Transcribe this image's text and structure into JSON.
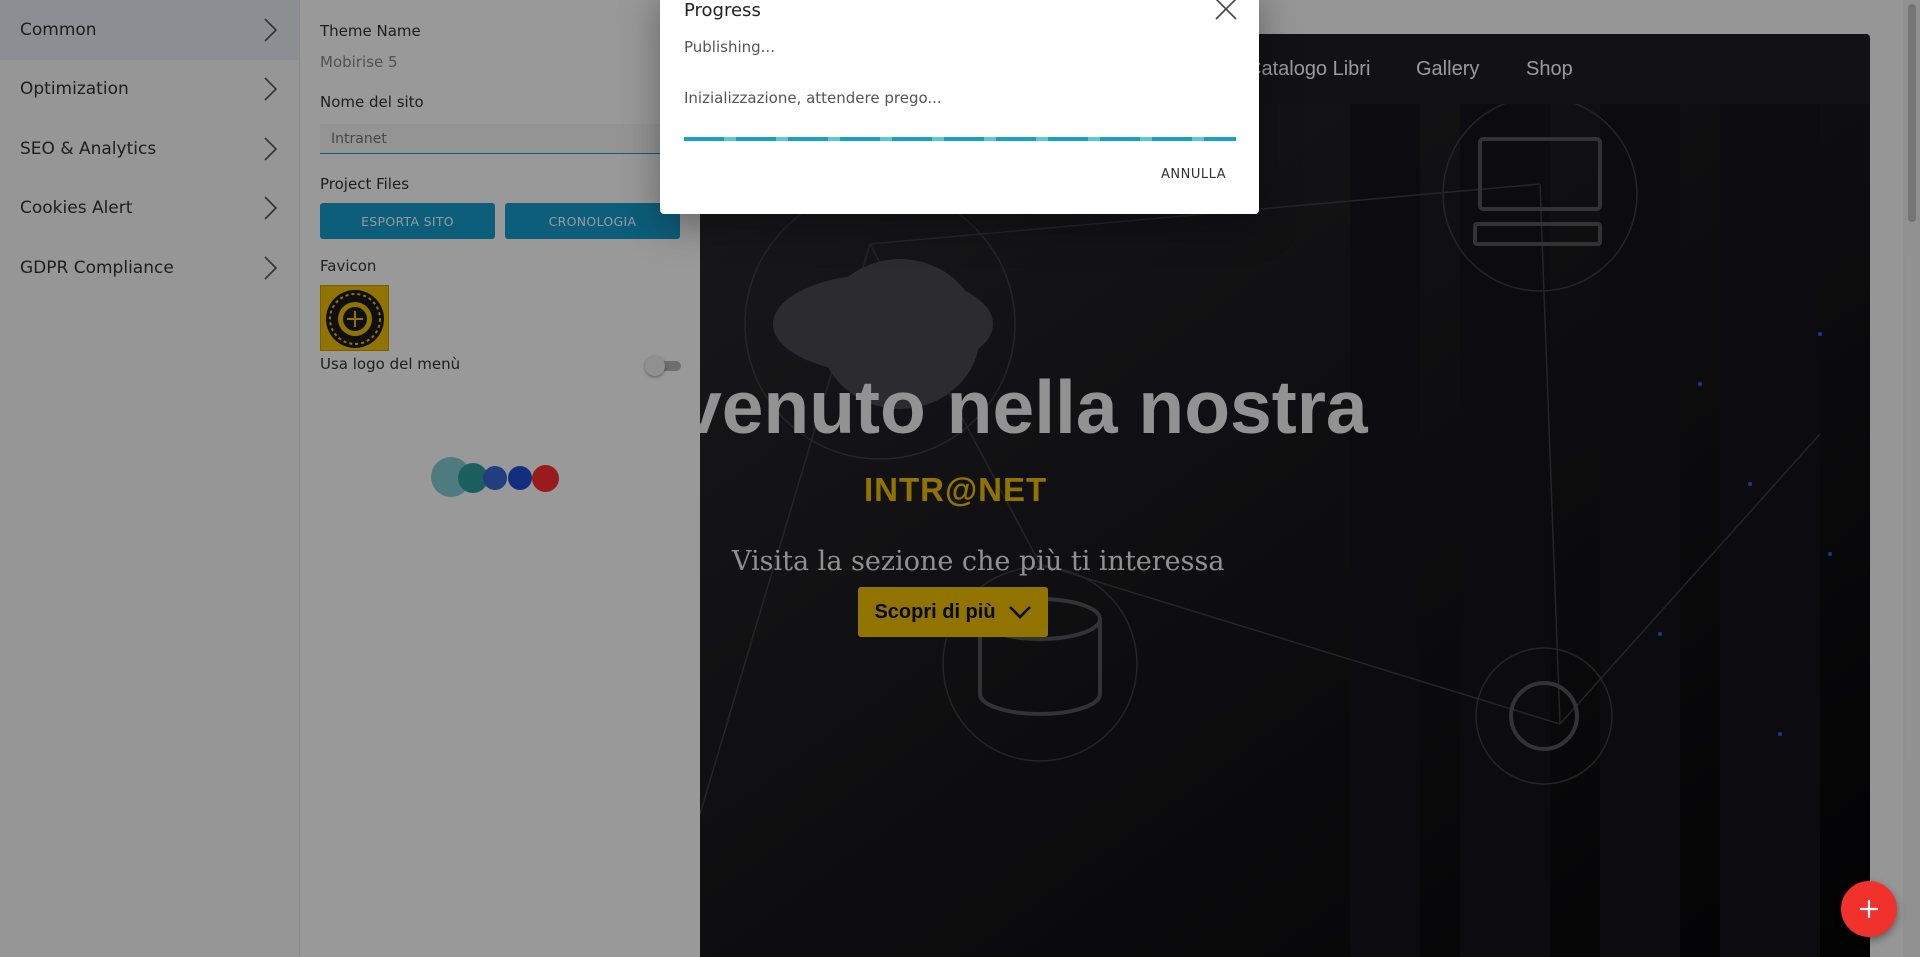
{
  "left_menu": {
    "items": [
      {
        "label": "Common",
        "active": true
      },
      {
        "label": "Optimization"
      },
      {
        "label": "SEO & Analytics"
      },
      {
        "label": "Cookies Alert"
      },
      {
        "label": "GDPR Compliance"
      }
    ]
  },
  "settings": {
    "theme_label": "Theme Name",
    "theme_value": "Mobirise 5",
    "site_name_label": "Nome del sito",
    "site_name_value": "Intranet",
    "project_files_label": "Project Files",
    "export_button": "ESPORTA SITO",
    "history_button": "CRONOLOGIA",
    "favicon_label": "Favicon",
    "use_logo_label": "Usa logo del menù",
    "use_logo_on": false
  },
  "preview": {
    "nav_links": [
      "Catalogo Libri",
      "Gallery",
      "Shop"
    ],
    "hero_title": "venuto nella nostra",
    "hero_brand": "INTR@NET",
    "hero_subtitle": "Visita la sezione che più ti interessa",
    "hero_button": "Scopri di più"
  },
  "progress_dialog": {
    "title": "Progress",
    "status": "Publishing...",
    "message": "Inizializzazione, attendere prego...",
    "progress": 1.0,
    "cancel_button": "ANNULLA"
  },
  "colors": {
    "accent": "#149dcc",
    "brand_yellow": "#f2c200",
    "fab": "#f0312c"
  },
  "icons": {
    "menu_chevron": "chevron-right-icon",
    "close": "close-icon",
    "fab": "plus-icon",
    "hero_button": "chevron-down-icon"
  }
}
